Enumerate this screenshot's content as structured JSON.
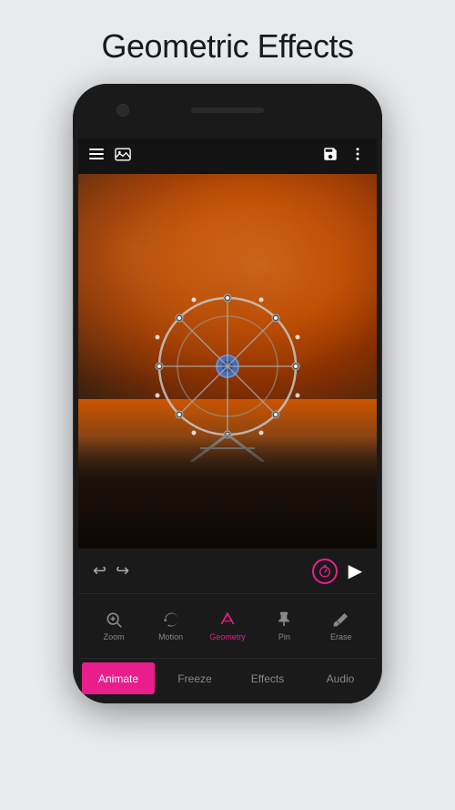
{
  "page": {
    "title": "Geometric Effects",
    "background_color": "#e8eaed"
  },
  "toolbar": {
    "hamburger_label": "menu",
    "image_label": "gallery",
    "save_label": "save",
    "more_label": "more options"
  },
  "playback": {
    "undo_label": "undo",
    "redo_label": "redo",
    "timer_label": "timer",
    "play_label": "play"
  },
  "tools": [
    {
      "id": "zoom",
      "label": "Zoom",
      "active": false
    },
    {
      "id": "motion",
      "label": "Motion",
      "active": false
    },
    {
      "id": "geometry",
      "label": "Geometry",
      "active": true
    },
    {
      "id": "pin",
      "label": "Pin",
      "active": false
    },
    {
      "id": "erase",
      "label": "Erase",
      "active": false
    }
  ],
  "tabs": [
    {
      "id": "animate",
      "label": "Animate",
      "active": true
    },
    {
      "id": "freeze",
      "label": "Freeze",
      "active": false
    },
    {
      "id": "effects",
      "label": "Effects",
      "active": false
    },
    {
      "id": "audio",
      "label": "Audio",
      "active": false
    }
  ],
  "colors": {
    "accent": "#e91e8c",
    "bg_dark": "#1a1a1a",
    "text_inactive": "#888888"
  }
}
